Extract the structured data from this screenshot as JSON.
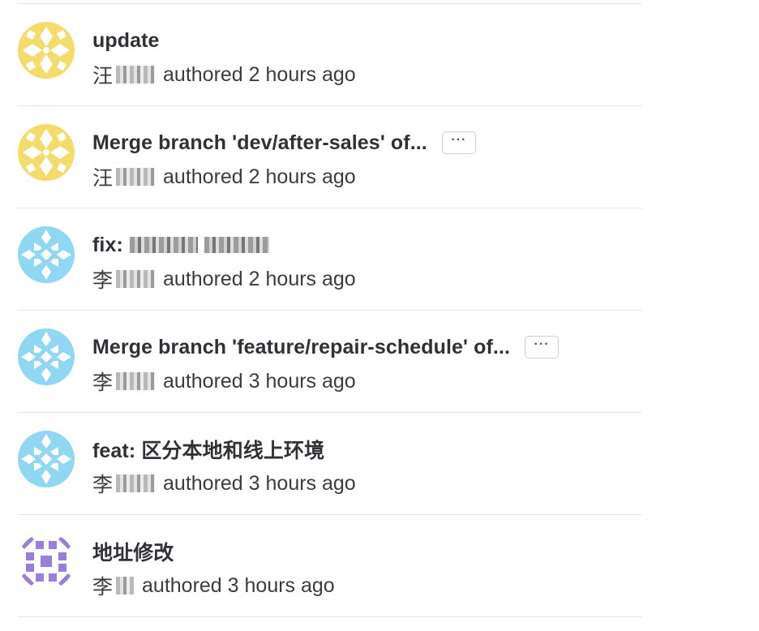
{
  "commits": [
    {
      "title": "update",
      "has_ellipsis": false,
      "author_surname": "汪",
      "authored_label": "authored",
      "time": "2 hours ago",
      "avatar_color": "#f3dc6b"
    },
    {
      "title": "Merge branch 'dev/after-sales' of...",
      "has_ellipsis": true,
      "ellipsis_label": "···",
      "author_surname": "汪",
      "authored_label": "authored",
      "time": "2 hours ago",
      "avatar_color": "#f3dc6b"
    },
    {
      "title": "fix:",
      "title_redacted": true,
      "has_ellipsis": false,
      "author_surname": "李",
      "authored_label": "authored",
      "time": "2 hours ago",
      "avatar_color": "#8fd7f3"
    },
    {
      "title": "Merge branch 'feature/repair-schedule' of...",
      "has_ellipsis": true,
      "ellipsis_label": "···",
      "author_surname": "李",
      "authored_label": "authored",
      "time": "3 hours ago",
      "avatar_color": "#8fd7f3"
    },
    {
      "title": "feat: 区分本地和线上环境",
      "has_ellipsis": false,
      "author_surname": "李",
      "authored_label": "authored",
      "time": "3 hours ago",
      "avatar_color": "#8fd7f3"
    },
    {
      "title": "地址修改",
      "has_ellipsis": false,
      "author_surname": "李",
      "authored_label": "authored",
      "time": "3 hours ago",
      "avatar_color": "#9a7fd9"
    }
  ]
}
